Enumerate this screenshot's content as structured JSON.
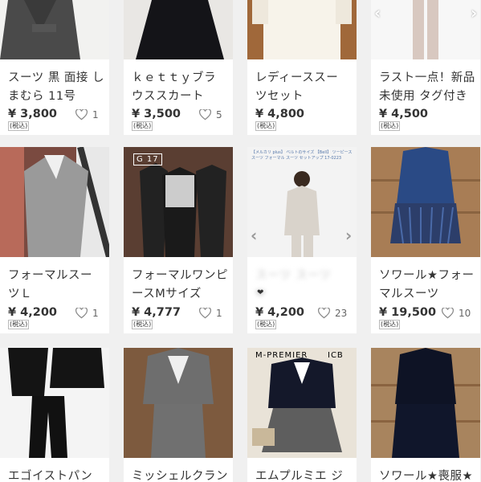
{
  "currency": "¥",
  "tax_label": "(税込)",
  "items": [
    {
      "id": "r1c1",
      "title": "スーツ 黒 面接 し\nまむら 11号",
      "price": "3,800",
      "likes": "1"
    },
    {
      "id": "r1c2",
      "title": "ｋｅｔｔｙブラ\nウススカート",
      "price": "3,500",
      "likes": "5"
    },
    {
      "id": "r1c3",
      "title": "レディーススー\nツセット",
      "price": "4,800",
      "likes": ""
    },
    {
      "id": "r1c4",
      "title": "ラスト一点！新品\n未使用 タグ付き",
      "price": "4,500",
      "likes": ""
    },
    {
      "id": "r2c1",
      "title": "フォーマルスー\nツＬ",
      "price": "4,200",
      "likes": "1"
    },
    {
      "id": "r2c2",
      "title": "フォーマルワンピ\nースMサイズ",
      "price": "4,777",
      "likes": "1"
    },
    {
      "id": "r2c3",
      "title": "スーツ スーツ\n❤",
      "price": "4,200",
      "likes": "23"
    },
    {
      "id": "r2c4",
      "title": "ソワール★フォー\nマルスーツ",
      "price": "19,500",
      "likes": "10"
    },
    {
      "id": "r3c1",
      "title": "エゴイストパン",
      "price": "",
      "likes": ""
    },
    {
      "id": "r3c2",
      "title": "ミッシェルクラン",
      "price": "",
      "likes": ""
    },
    {
      "id": "r3c3",
      "title": "エムプルミエ ジ",
      "price": "",
      "likes": ""
    },
    {
      "id": "r3c4",
      "title": "ソワール★喪服★",
      "price": "",
      "likes": ""
    }
  ],
  "photo_texts": {
    "r2c2_badge": "G 17",
    "r2c3_caption": "【メルカリ plus】 ベルトのサイズ 【Bell】 ツーピーススーツ フォーマル スーツ セットアップ 17-0223",
    "r3c3_brand": "M-PREMIER",
    "r3c3_brand2": "ICB"
  },
  "colors": {
    "background": "#f0f0f0",
    "card": "#ffffff",
    "text": "#333333"
  }
}
